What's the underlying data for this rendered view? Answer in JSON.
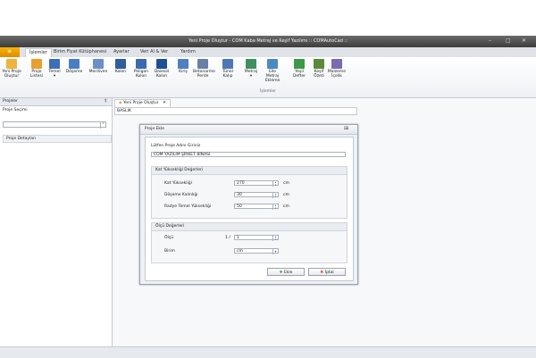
{
  "window": {
    "title": "Yeni Proje Oluştur - COM Kaba Metraj ve Keşif Yazılımı :: COMAutoCad ::"
  },
  "ribbon": {
    "tabs": [
      "İşlemler",
      "Birim Fiyat Kütüphanesi",
      "Ayarlar",
      "Veri Al & Ver",
      "Yardım"
    ],
    "active_tab": "İşlemler",
    "buttons": [
      {
        "label1": "Yeni Proje",
        "label2": "Oluştur",
        "icon": "new-project-icon",
        "color": "#f0b43c"
      },
      {
        "label1": "Proje",
        "label2": "Listesi",
        "icon": "folder-icon",
        "color": "#e8a030"
      },
      {
        "label1": "Temel",
        "label2": "▾",
        "icon": "foundation-icon",
        "color": "#3d6fb8"
      },
      {
        "label1": "Döşeme",
        "label2": "",
        "icon": "slab-icon",
        "color": "#4a7ec4"
      },
      {
        "label1": "Merdiven",
        "label2": "",
        "icon": "stairs-icon",
        "color": "#6b8fc9"
      },
      {
        "label1": "Kolon",
        "label2": "",
        "icon": "column-icon",
        "color": "#2f5d9e"
      },
      {
        "label1": "Poligon",
        "label2": "Kolon",
        "icon": "polygon-column-icon",
        "color": "#3c6ab0"
      },
      {
        "label1": "Daiesel",
        "label2": "Kolon",
        "icon": "circular-column-icon",
        "color": "#1f4f93"
      },
      {
        "label1": "Kiriş",
        "label2": "",
        "icon": "beam-icon",
        "color": "#4f7fc0"
      },
      {
        "label1": "Betonarme",
        "label2": "Perde",
        "icon": "shear-wall-icon",
        "color": "#6a7fa8"
      },
      {
        "label1": "Tünel",
        "label2": "Kalıp",
        "icon": "tunnel-form-icon",
        "color": "#4c78b8"
      },
      {
        "label1": "Metraj",
        "label2": "▾",
        "icon": "quantity-icon",
        "color": "#3f8f5f"
      },
      {
        "label1": "Elle Metraj",
        "label2": "Ekleme",
        "icon": "manual-quantity-icon",
        "color": "#4a8ac0"
      },
      {
        "label1": "Yeşil",
        "label2": "Defter",
        "icon": "green-book-icon",
        "color": "#3a9a4a"
      },
      {
        "label1": "Keşif",
        "label2": "Özeti",
        "icon": "estimate-summary-icon",
        "color": "#5a8a3a"
      },
      {
        "label1": "Malzeme",
        "label2": "İçelik",
        "icon": "material-icon",
        "color": "#7a6ab0"
      }
    ],
    "group_label": "İşlemler"
  },
  "left_pane": {
    "title": "Projeler",
    "pin": "‡",
    "section1": "Proje Seçimi",
    "section2": "Proje Detayları"
  },
  "document": {
    "tab_label": "Yeni Proje Oluştur",
    "mode_text": "BASLIK"
  },
  "dialog": {
    "title": "Proje Ekle",
    "close_glyph": "⌧",
    "prompt": "Lütfen Proje Adını Giriniz",
    "project_name": "COM YAZILIM ŞİRKET BİNASI",
    "group1": {
      "title": "Kat Yüksekliği Değerleri",
      "rows": [
        {
          "label": "Kat Yüksekliği",
          "value": "270",
          "unit": "cm"
        },
        {
          "label": "Döşeme Kalınlığı",
          "value": "30",
          "unit": "cm"
        },
        {
          "label": "Radye Temel Yüksekliği",
          "value": "50",
          "unit": "cm"
        }
      ]
    },
    "group2": {
      "title": "Ölçü Değerleri",
      "scale_label": "Ölçü",
      "scale_num": "1 /",
      "scale_value": "1",
      "unit_label": "Birim",
      "unit_value": "cm"
    },
    "ok_label": "Ekle",
    "cancel_label": "İptal"
  }
}
